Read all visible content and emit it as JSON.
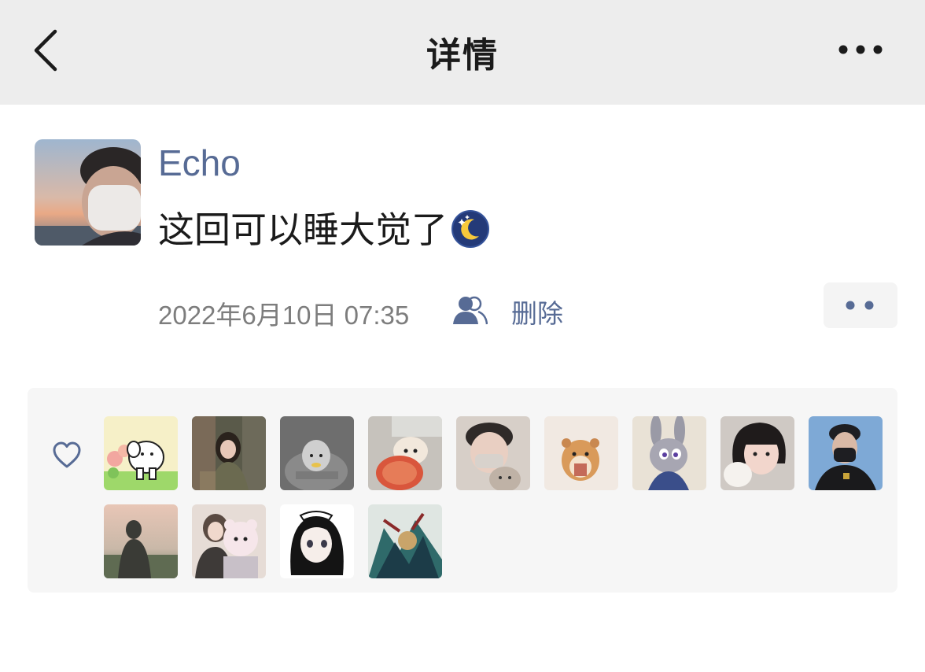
{
  "nav": {
    "title": "详情",
    "back_icon": "chevron-left-icon",
    "more_icon": "more-horizontal-icon"
  },
  "post": {
    "author": "Echo",
    "text": "这回可以睡大觉了",
    "emoji": "moon-stars-emoji",
    "timestamp": "2022年6月10日 07:35",
    "visibility_icon": "friends-visibility-icon",
    "delete_label": "删除",
    "comment_icon": "comment-dots-icon"
  },
  "likes": {
    "icon": "heart-outline-icon",
    "avatars": [
      {
        "name": "like-avatar-1"
      },
      {
        "name": "like-avatar-2"
      },
      {
        "name": "like-avatar-3"
      },
      {
        "name": "like-avatar-4"
      },
      {
        "name": "like-avatar-5"
      },
      {
        "name": "like-avatar-6"
      },
      {
        "name": "like-avatar-7"
      },
      {
        "name": "like-avatar-8"
      },
      {
        "name": "like-avatar-9"
      },
      {
        "name": "like-avatar-10"
      },
      {
        "name": "like-avatar-11"
      },
      {
        "name": "like-avatar-12"
      },
      {
        "name": "like-avatar-13"
      }
    ]
  },
  "colors": {
    "link": "#576b95",
    "nav_bg": "#ededed",
    "panel_bg": "#f6f6f6"
  }
}
